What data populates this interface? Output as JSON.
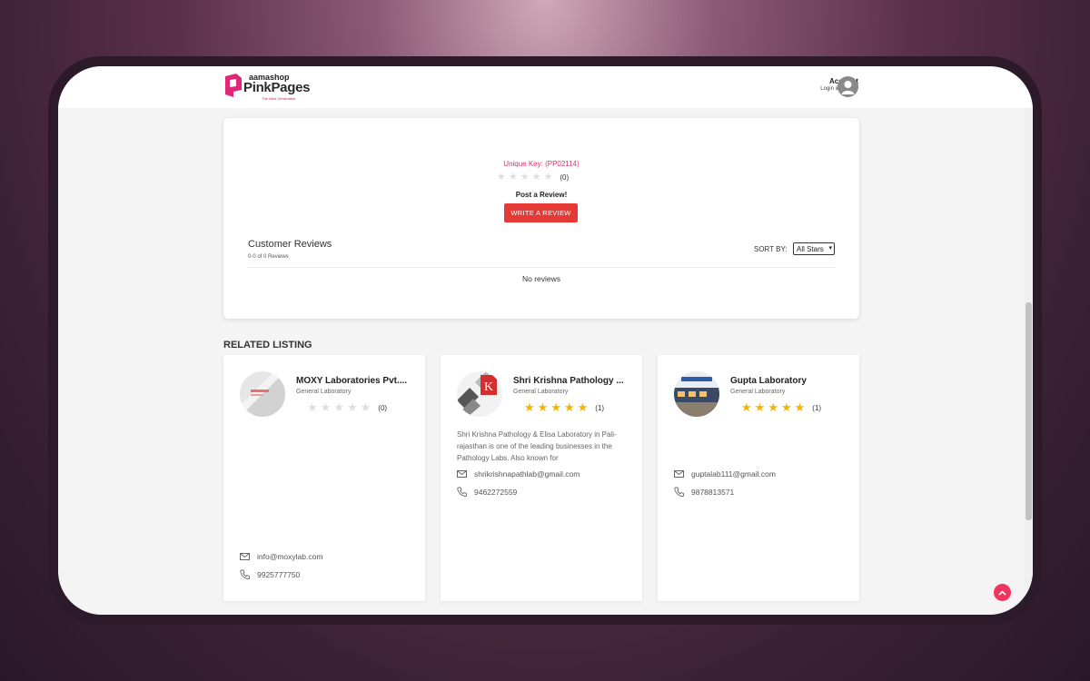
{
  "header": {
    "logo_small": "aamashop",
    "logo_big": "PinkPages",
    "logo_tagline": "The Next Generation",
    "account_title": "Account",
    "account_subtitle": "Login & SignUp"
  },
  "review_section": {
    "unique_key": "Unique Key: (PP02114)",
    "rating_value": 0,
    "rating_count": "(0)",
    "post_review_label": "Post a Review!",
    "write_review_button": "WRITE A REVIEW",
    "customer_reviews_title": "Customer Reviews",
    "reviews_count": "0-0 of 0 Reviews",
    "sort_by_label": "SORT BY:",
    "sort_selected": "All Stars",
    "empty_text": "No reviews"
  },
  "related": {
    "title": "RELATED LISTING",
    "listings": [
      {
        "name": "MOXY Laboratories Pvt....",
        "category": "General Laboratory",
        "rating": 0,
        "rating_count": "(0)",
        "description": "",
        "email": "info@moxylab.com",
        "phone": "9925777750"
      },
      {
        "name": "Shri Krishna Pathology ...",
        "category": "General Laboratory",
        "rating": 5,
        "rating_count": "(1)",
        "description": "Shri Krishna Pathology & Elisa Laboratory in Pali-rajasthan is one of the leading businesses in the Pathology Labs. Also known for",
        "email": "shrikrishnapathlab@gmail.com",
        "phone": "9462272559"
      },
      {
        "name": "Gupta Laboratory",
        "category": "General Laboratory",
        "rating": 5,
        "rating_count": "(1)",
        "description": "",
        "email": "guptalab111@gmail.com",
        "phone": "9878813571"
      }
    ]
  },
  "colors": {
    "brand_pink": "#d6336c",
    "button_red": "#e53935",
    "star_gold": "#f4b400",
    "star_empty": "#dedede",
    "back_to_top": "#f0365f"
  },
  "icons": {
    "email": "envelope-icon",
    "phone": "phone-icon",
    "back_to_top": "chevron-up-icon",
    "avatar": "user-avatar-icon"
  }
}
